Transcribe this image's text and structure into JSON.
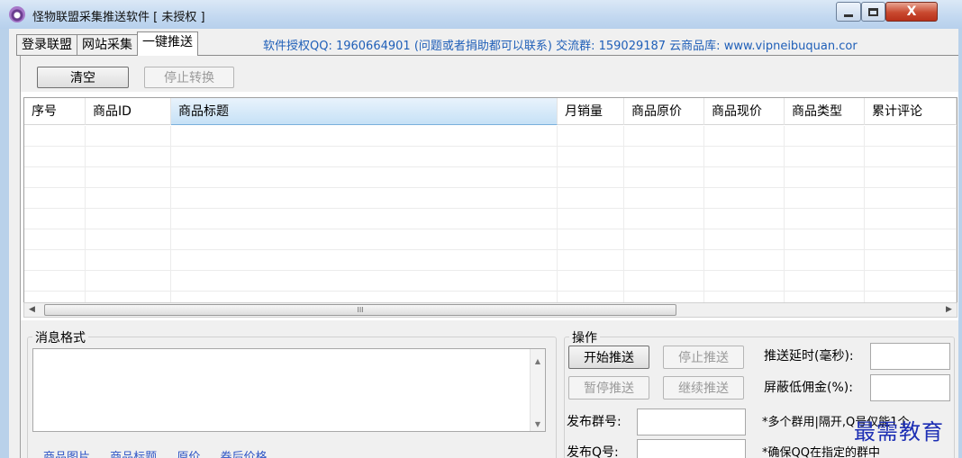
{
  "window": {
    "title": "怪物联盟采集推送软件 [ 未授权 ]",
    "controls": [
      "minimize",
      "maximize",
      "close"
    ],
    "close_glyph": "X"
  },
  "tabs": [
    {
      "label": "登录联盟",
      "active": false
    },
    {
      "label": "网站采集",
      "active": false
    },
    {
      "label": "一键推送",
      "active": true
    }
  ],
  "info_text": "软件授权QQ: 1960664901 (问题或者捐助都可以联系) 交流群: 159029187 云商品库: www.vipneibuquan.cor",
  "toolbar": {
    "clear_label": "清空",
    "stop_convert_label": "停止转换"
  },
  "table": {
    "columns": [
      "序号",
      "商品ID",
      "商品标题",
      "月销量",
      "商品原价",
      "商品现价",
      "商品类型",
      "累计评论"
    ],
    "rows": []
  },
  "scrollbar": {
    "grip": "III"
  },
  "message": {
    "group_title": "消息格式",
    "value": "",
    "insert_links": [
      "商品图片",
      "商品标题",
      "原价",
      "券后价格"
    ]
  },
  "operations": {
    "group_title": "操作",
    "start_push_label": "开始推送",
    "stop_push_label": "停止推送",
    "pause_push_label": "暂停推送",
    "resume_push_label": "继续推送",
    "group_no_label": "发布群号:",
    "group_no_value": "",
    "qq_no_label": "发布Q号:",
    "qq_no_value": "",
    "delay_label": "推送延时(毫秒):",
    "delay_value": "",
    "min_commission_label": "屏蔽低佣金(%):",
    "min_commission_value": "",
    "note_multi_group": "*多个群用|隔开,Q号仅能1个",
    "note_qq_in_group": "*确保QQ在指定的群中"
  },
  "watermark": "最需教育",
  "colors": {
    "info_text": "#1f5fb8",
    "link_text": "#2f56c6",
    "watermark": "#1d2fb4",
    "selected_header": "#c6e1f6"
  }
}
